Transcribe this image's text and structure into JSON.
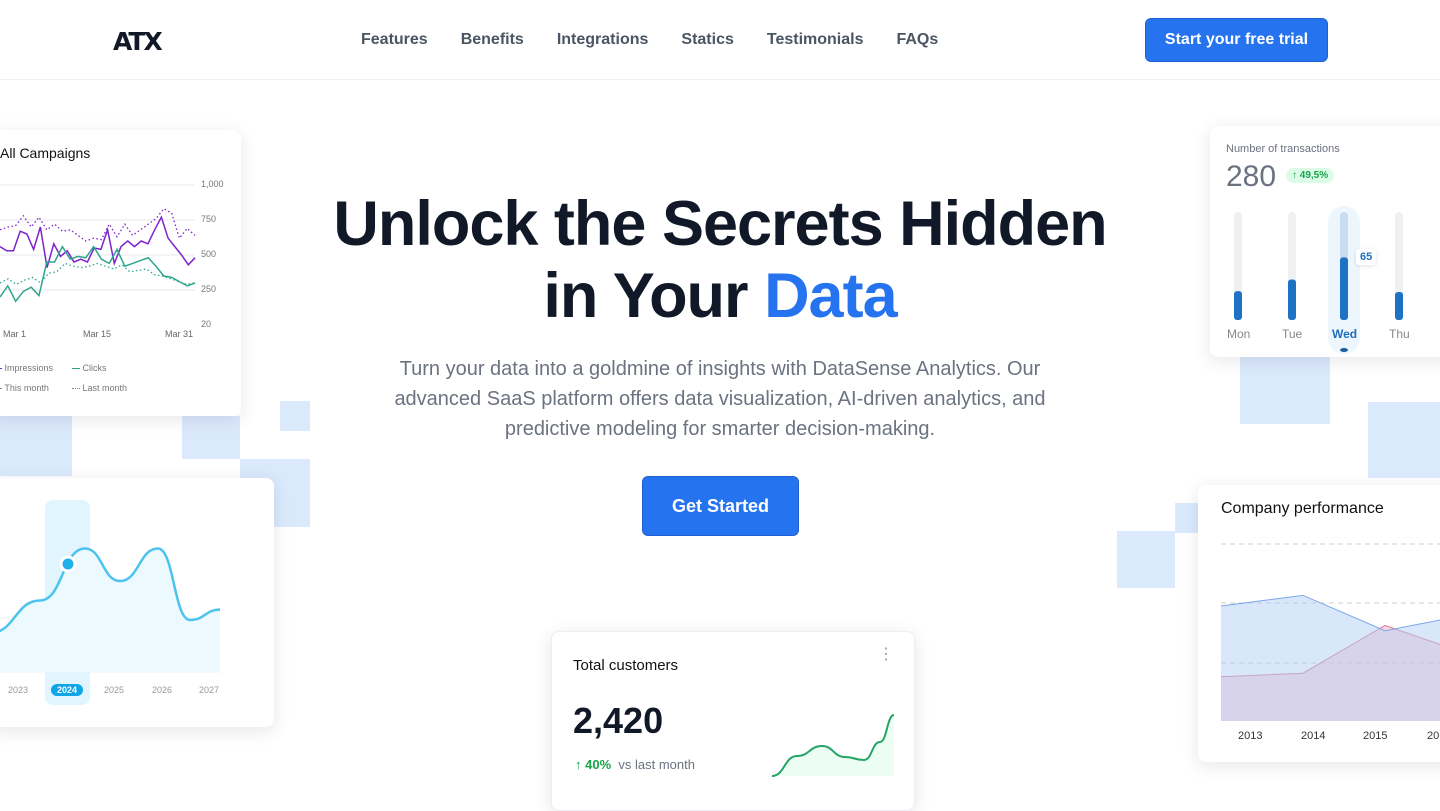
{
  "nav": {
    "logo": "ATX",
    "links": [
      "Features",
      "Benefits",
      "Integrations",
      "Statics",
      "Testimonials",
      "FAQs"
    ],
    "cta": "Start your free trial"
  },
  "hero": {
    "title_line1": "Unlock the Secrets Hidden",
    "title_line2_prefix": "in Your ",
    "title_line2_accent": "Data",
    "subtitle": "Turn your data into a goldmine of insights with DataSense Analytics. Our advanced SaaS platform offers data visualization, AI-driven analytics, and predictive modeling for smarter decision-making.",
    "button": "Get Started"
  },
  "colors": {
    "accent": "#2673f0",
    "impressions": "#7e22ce",
    "clicks": "#2fa58e",
    "positive": "#16a34a"
  },
  "campaigns": {
    "title": "All Campaigns",
    "y_ticks": [
      "1,000",
      "750",
      "500",
      "250",
      "20"
    ],
    "x_ticks": [
      "Mar 1",
      "Mar 15",
      "Mar 31"
    ],
    "legend": {
      "impressions": "Impressions",
      "clicks": "Clicks",
      "this_month": "This month",
      "last_month": "Last month"
    },
    "series": {
      "impressions": [
        560,
        530,
        530,
        670,
        650,
        540,
        700,
        410,
        580,
        490,
        530,
        450,
        470,
        450,
        550,
        540,
        680,
        440,
        560,
        600,
        560,
        600,
        580,
        680,
        770,
        620,
        560,
        500,
        430,
        480
      ],
      "impressions_last": [
        680,
        700,
        710,
        780,
        700,
        770,
        680,
        720,
        670,
        680,
        640,
        600,
        620,
        610,
        720,
        630,
        720,
        640,
        680,
        720,
        760,
        830,
        800,
        620,
        690,
        640
      ],
      "clicks": [
        200,
        280,
        170,
        240,
        270,
        210,
        450,
        450,
        560,
        470,
        490,
        480,
        560,
        470,
        440,
        540,
        420,
        440,
        460,
        480,
        420,
        350,
        340,
        310,
        280,
        300
      ],
      "clicks_last": [
        300,
        330,
        290,
        320,
        340,
        300,
        370,
        380,
        440,
        420,
        410,
        420,
        440,
        420,
        400,
        430,
        380,
        390,
        400,
        360,
        350,
        330,
        310,
        290,
        300
      ]
    }
  },
  "forecast": {
    "x_ticks": [
      "2023",
      "2024",
      "2025",
      "2026",
      "2027"
    ],
    "selected": "2024",
    "values": [
      30,
      55,
      95,
      70,
      95,
      40,
      48
    ]
  },
  "transactions": {
    "label": "Number of transactions",
    "value": "280",
    "change": "49,5%",
    "days": [
      "Mon",
      "Tue",
      "Wed",
      "Thu"
    ],
    "bars": [
      30,
      42,
      65,
      29
    ],
    "selected_day": "Wed",
    "tooltip": "65"
  },
  "performance": {
    "title": "Company performance",
    "x_ticks": [
      "2013",
      "2014",
      "2015",
      "20"
    ],
    "series_a": [
      65,
      71,
      51,
      60,
      68
    ],
    "series_b": [
      25,
      27,
      54,
      38,
      30
    ]
  },
  "customers": {
    "title": "Total customers",
    "value": "2,420",
    "change": "40%",
    "change_label": "vs last month",
    "trend": [
      5,
      30,
      45,
      30,
      25,
      45,
      90,
      95
    ]
  }
}
